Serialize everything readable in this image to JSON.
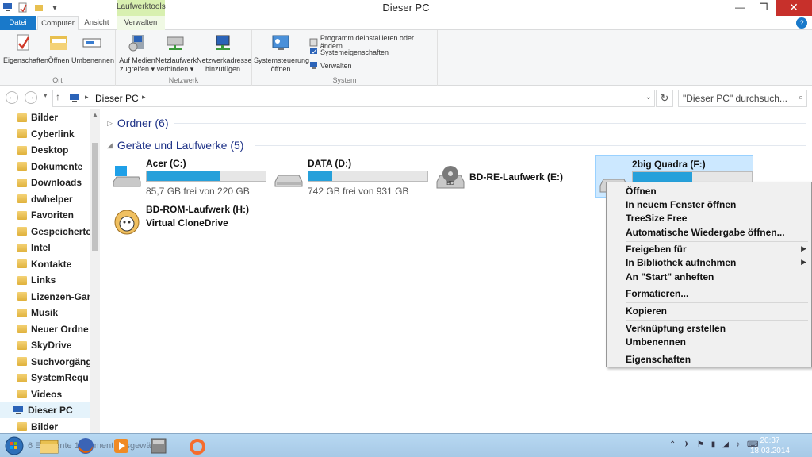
{
  "window": {
    "title": "Dieser PC",
    "context_tab": "Laufwerktools",
    "controls": {
      "minimize": "—",
      "maximize": "❐",
      "close": "✕"
    }
  },
  "tabs": [
    {
      "label": "Datei",
      "active": false
    },
    {
      "label": "Computer",
      "active": true
    },
    {
      "label": "Ansicht",
      "active": false
    },
    {
      "label": "Verwalten",
      "active": false
    }
  ],
  "ribbon": {
    "groups": {
      "ort": "Ort",
      "netzwerk": "Netzwerk",
      "system": "System"
    },
    "buttons": {
      "eigenschaften": "Eigenschaften",
      "oeffnen": "Öffnen",
      "umbenennen": "Umbenennen",
      "auf_medien_1": "Auf Medien",
      "auf_medien_2": "zugreifen ▾",
      "netzlaufwerk_1": "Netzlaufwerk",
      "netzlaufwerk_2": "verbinden ▾",
      "netzwerkadresse_1": "Netzwerkadresse",
      "netzwerkadresse_2": "hinzufügen",
      "systemsteuerung_1": "Systemsteuerung",
      "systemsteuerung_2": "öffnen",
      "programm": "Programm deinstallieren oder ändern",
      "systemeigenschaften": "Systemeigenschaften",
      "verwalten": "Verwalten"
    }
  },
  "address": {
    "path": "Dieser PC",
    "search_placeholder": "\"Dieser PC\" durchsuch..."
  },
  "nav": {
    "items": [
      "Bilder",
      "Cyberlink",
      "Desktop",
      "Dokumente",
      "Downloads",
      "dwhelper",
      "Favoriten",
      "Gespeicherte",
      "Intel",
      "Kontakte",
      "Links",
      "Lizenzen-Gam",
      "Musik",
      "Neuer Ordne",
      "SkyDrive",
      "Suchvorgänge",
      "SystemRequ",
      "Videos"
    ],
    "this_pc": "Dieser PC",
    "sub_bilder": "Bilder"
  },
  "sections": {
    "folders": "Ordner (6)",
    "devices": "Geräte und Laufwerke (5)"
  },
  "drives": [
    {
      "name": "Acer (C:)",
      "free": "85,7 GB frei von 220 GB",
      "used_fraction": 0.61
    },
    {
      "name": "DATA (D:)",
      "free": "742 GB frei von 931 GB",
      "used_fraction": 0.2
    },
    {
      "name": "BD-RE-Laufwerk (E:)"
    },
    {
      "name": "2big Quadra (F:)",
      "used_fraction": 0.5
    },
    {
      "name": "BD-ROM-Laufwerk (H:)",
      "sub": "Virtual CloneDrive"
    }
  ],
  "context_menu": {
    "items": [
      "Öffnen",
      "In neuem Fenster öffnen",
      "TreeSize Free",
      "Automatische Wiedergabe öffnen...",
      "Freigeben für",
      "In Bibliothek aufnehmen",
      "An \"Start\" anheften",
      "Formatieren...",
      "Kopieren",
      "Verknüpfung erstellen",
      "Umbenennen",
      "Eigenschaften"
    ]
  },
  "statusbar": {
    "ghost": "6 Elemente   1 Element ausgewählt"
  },
  "clock": {
    "time": "20:37",
    "date": "18.03.2014"
  }
}
